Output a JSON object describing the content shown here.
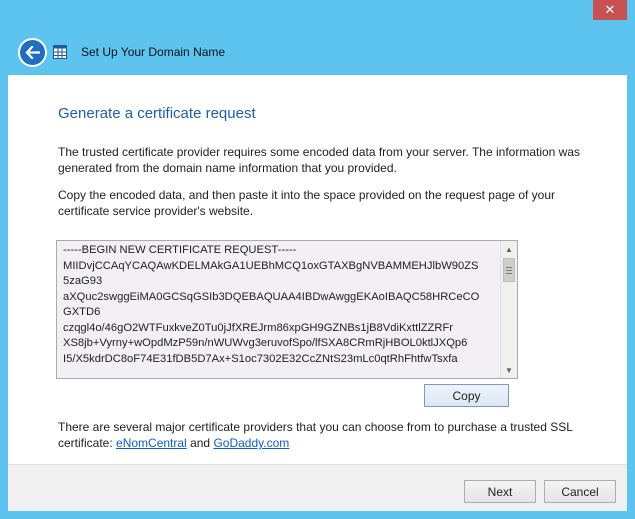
{
  "window": {
    "title": "Set Up Your Domain Name",
    "close_glyph": "✕"
  },
  "icons": {
    "back": "back-arrow-icon",
    "app": "window-grid-icon",
    "close": "close-icon"
  },
  "colors": {
    "frame": "#5cc4ef",
    "heading": "#1f5fa8",
    "link": "#0b5fc2",
    "close": "#c75050",
    "back_button": "#1e6fc0"
  },
  "page": {
    "heading": "Generate a certificate request",
    "para1": "The trusted certificate provider requires some encoded data from your server. The information was generated from the domain name information that you provided.",
    "para2": "Copy the encoded data, and then paste it into the space provided on the request page of your certificate service provider's website.",
    "certificate_text": "-----BEGIN NEW CERTIFICATE REQUEST-----\nMIIDvjCCAqYCAQAwKDELMAkGA1UEBhMCQ1oxGTAXBgNVBAMMEHJlbW90ZS\n5zaG93\naXQuc2swggEiMA0GCSqGSIb3DQEBAQUAA4IBDwAwggEKAoIBAQC58HRCeCO\nGXTD6\nczqgl4o/46gO2WTFuxkveZ0Tu0jJfXREJrm86xpGH9GZNBs1jB8VdiKxttlZZRFr\nXS8jb+Vyrny+wOpdMzP59n/nWUWvg3eruvofSpo/lfSXA8CRmRjHBOL0ktlJXQp6\nI5/X5kdrDC8oF74E31fDB5D7Ax+S1oc7302E32CcZNtS23mLc0qtRhFhtfwTsxfa",
    "copy_label": "Copy",
    "para3_prefix": "There are several major certificate providers that you can choose from to purchase a trusted SSL certificate: ",
    "link1": "eNomCentral",
    "and_word": " and ",
    "link2": "GoDaddy.com"
  },
  "footer": {
    "next_label": "Next",
    "cancel_label": "Cancel"
  }
}
